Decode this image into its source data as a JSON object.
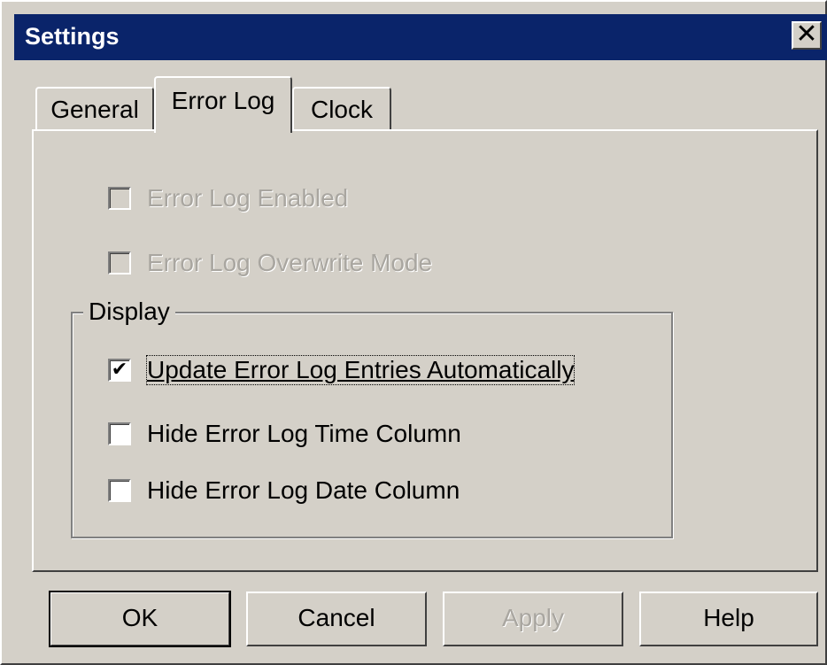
{
  "window": {
    "title": "Settings",
    "close_glyph": "✕"
  },
  "tabs": [
    {
      "label": "General",
      "active": false
    },
    {
      "label": "Error Log",
      "active": true
    },
    {
      "label": "Clock",
      "active": false
    }
  ],
  "options": [
    {
      "label": "Error Log Enabled",
      "checked": false,
      "enabled": false
    },
    {
      "label": "Error Log Overwrite Mode",
      "checked": false,
      "enabled": false
    }
  ],
  "display_group": {
    "title": "Display",
    "options": [
      {
        "label": "Update Error Log Entries Automatically",
        "checked": true,
        "enabled": true,
        "check_glyph": "✔"
      },
      {
        "label": "Hide Error Log Time Column",
        "checked": false,
        "enabled": true
      },
      {
        "label": "Hide Error Log Date Column",
        "checked": false,
        "enabled": true
      }
    ]
  },
  "buttons": {
    "ok": "OK",
    "cancel": "Cancel",
    "apply": "Apply",
    "help": "Help"
  }
}
